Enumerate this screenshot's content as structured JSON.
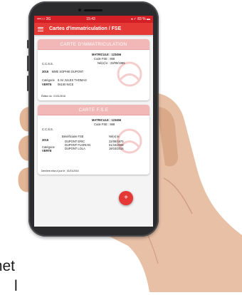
{
  "caption": {
    "line1": "met",
    "line2": "l"
  },
  "status_bar": {
    "carrier": "•••○○ 3G",
    "time": "15:43",
    "battery": "◂ ✓ 83 % ▬"
  },
  "app_bar": {
    "title": "Cartes d'immatriculation / FSE"
  },
  "card_immat": {
    "header": "CARTE D'IMMATRICULATION",
    "matricule_label": "MATRICULE :",
    "matricule_value": "123456",
    "code_fse_label": "Code FSE :",
    "code_fse_value": "868",
    "birth_label": "Né(e) le :",
    "birth_value": "23/09/1985",
    "ccss": "C.C.S.S.",
    "year": "2016",
    "name": "MME SOPHIE DUPONT",
    "category_label": "Catégorie",
    "category_value": "VERTE",
    "address1": "8 AV JULES THOMAS",
    "address2": "06100 NICE",
    "edition": "Édition du : 01/01/2016"
  },
  "card_fse": {
    "header": "CARTE F.S.E",
    "matricule_label": "MATRICULE :",
    "matricule_value": "123456",
    "code_fse_label": "Code FSE :",
    "code_fse_value": "868",
    "ccss": "C.C.S.S.",
    "year": "2016",
    "beneficiaire_label": "Bénéficiaire FSE",
    "nele_label": "Né(e) le",
    "beneficiaries": [
      {
        "name": "DUPONT ERIC",
        "date": "22/08/1975"
      },
      {
        "name": "DUPONT FLORIAN",
        "date": "01/10/2008"
      },
      {
        "name": "DUPONT LOLA",
        "date": "19/10/2015"
      }
    ],
    "category_label": "Catégorie",
    "category_value": "VERTE",
    "last_update": "Dernière mise à jour le : 01/01/2016"
  },
  "fab": {
    "label": "+"
  },
  "colors": {
    "primary": "#e53935",
    "card_header": "#f2b8b8"
  }
}
